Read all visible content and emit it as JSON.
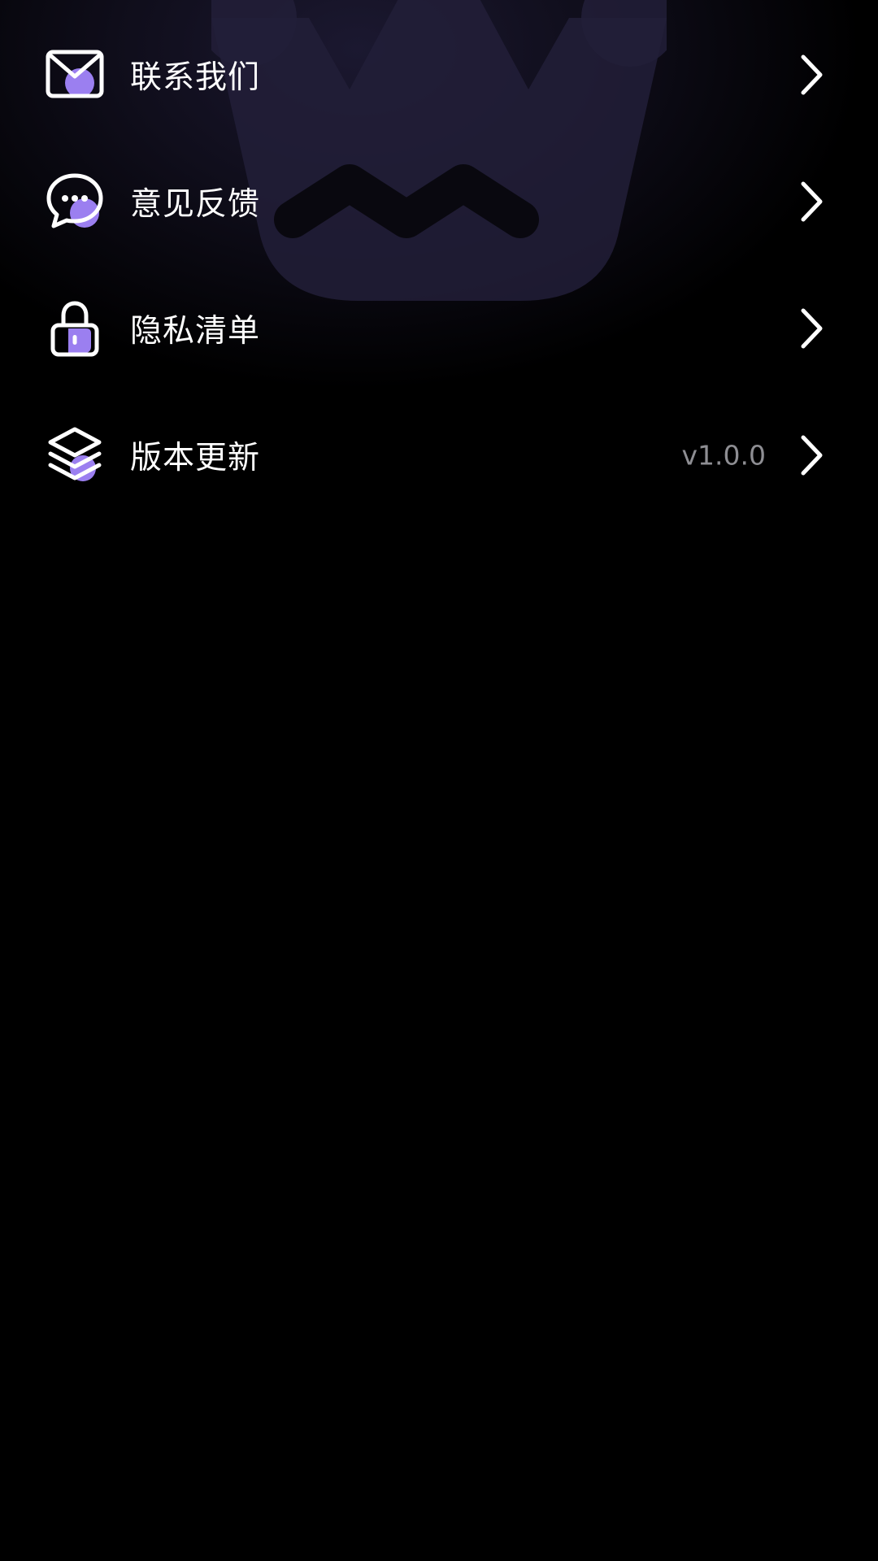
{
  "theme": {
    "background": "#000000",
    "accent": "#9b7ff0",
    "text": "#ffffff",
    "muted": "#8e8e93"
  },
  "menu": {
    "items": [
      {
        "id": "contact",
        "label": "联系我们",
        "icon": "mail-icon"
      },
      {
        "id": "feedback",
        "label": "意见反馈",
        "icon": "chat-bubble-icon"
      },
      {
        "id": "privacy",
        "label": "隐私清单",
        "icon": "lock-icon"
      },
      {
        "id": "update",
        "label": "版本更新",
        "icon": "layers-icon",
        "value": "v1.0.0"
      }
    ]
  }
}
